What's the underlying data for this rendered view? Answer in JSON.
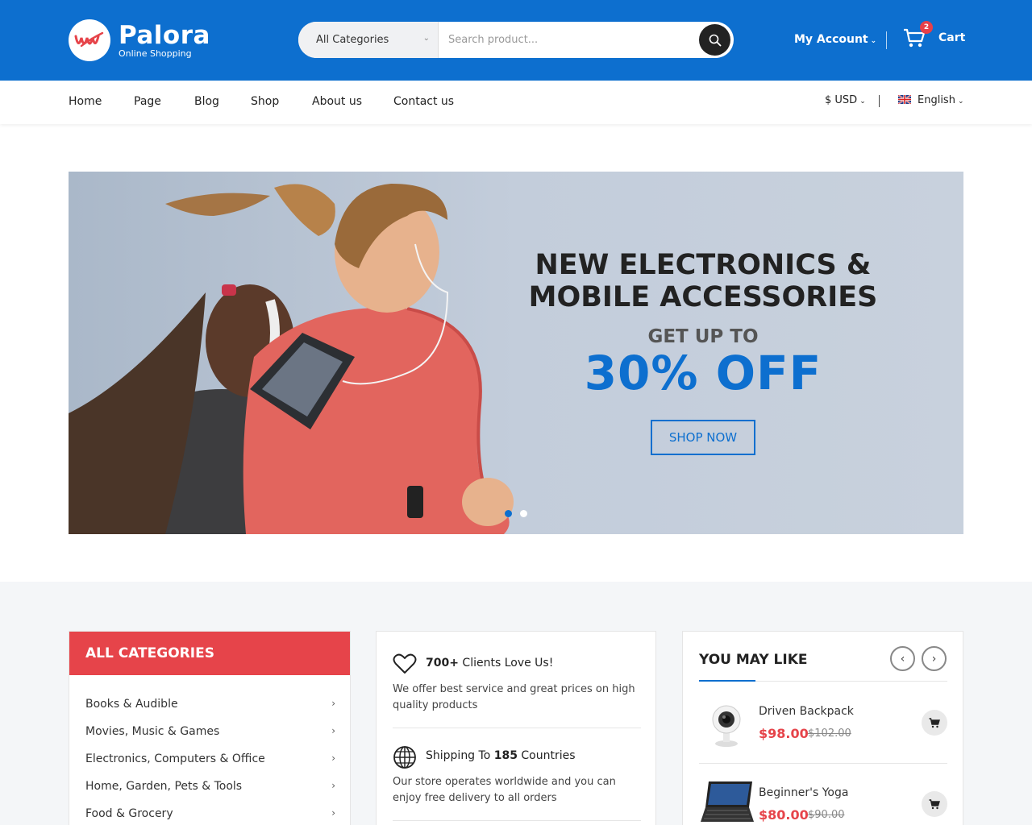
{
  "brand": {
    "name": "Palora",
    "tagline": "Online Shopping",
    "primary_color": "#0d6fcf",
    "accent_color": "#e6444a"
  },
  "search": {
    "category_selected": "All Categories",
    "placeholder": "Search product..."
  },
  "header": {
    "account_label": "My Account",
    "cart_label": "Cart",
    "cart_count": "2"
  },
  "nav": {
    "items": [
      "Home",
      "Page",
      "Blog",
      "Shop",
      "About us",
      "Contact us"
    ],
    "currency": "$ USD",
    "language": "English"
  },
  "hero": {
    "title_line1": "NEW ELECTRONICS &",
    "title_line2": "MOBILE ACCESSORIES",
    "subtitle": "GET UP TO",
    "discount": "30% OFF",
    "cta": "SHOP NOW",
    "slide_count": 2,
    "active_slide": 1
  },
  "categories": {
    "title": "ALL CATEGORIES",
    "items": [
      "Books & Audible",
      "Movies, Music & Games",
      "Electronics, Computers & Office",
      "Home, Garden, Pets & Tools",
      "Food & Grocery"
    ]
  },
  "features": [
    {
      "icon": "heart-icon",
      "title_strong": "700+",
      "title_rest": " Clients Love Us!",
      "text": "We offer best service and great prices on high quality products"
    },
    {
      "icon": "globe-icon",
      "title_prefix": "Shipping To ",
      "title_strong": "185",
      "title_rest": " Countries",
      "text": "Our store operates worldwide and you can enjoy free delivery to all orders"
    }
  ],
  "you_may_like": {
    "title": "YOU MAY LIKE",
    "products": [
      {
        "name": "Driven Backpack",
        "price": "$98.00",
        "old_price": "$102.00",
        "image": "webcam-image"
      },
      {
        "name": "Beginner's Yoga",
        "price": "$80.00",
        "old_price": "$90.00",
        "image": "tablet-keyboard-image"
      }
    ]
  }
}
